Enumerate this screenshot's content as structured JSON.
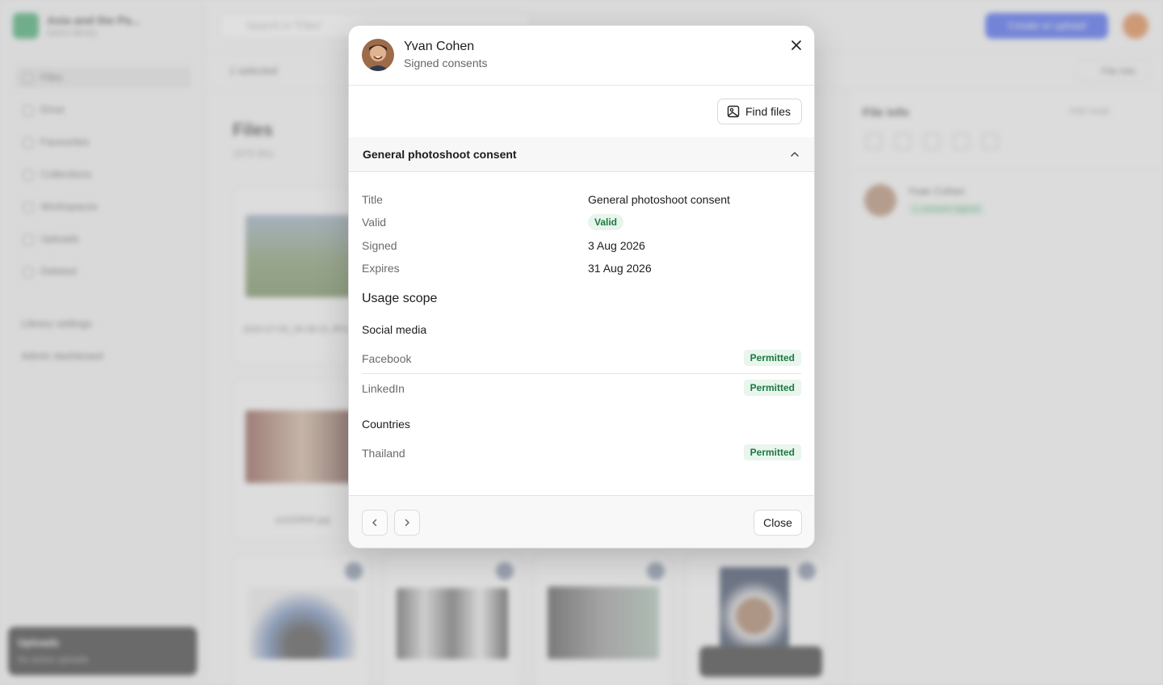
{
  "background": {
    "library": {
      "name": "Asia and the Pa...",
      "subtitle": "Demo library"
    },
    "nav": [
      "Files",
      "Drive",
      "Favourites",
      "Collections",
      "Workspaces",
      "Uploads",
      "Deleted"
    ],
    "nav_sections": [
      "Library settings",
      "Admin dashboard"
    ],
    "uploads_box": {
      "title": "Uploads",
      "subtitle": "No active uploads"
    },
    "search_placeholder": "Search in \"Files\"",
    "create_label": "Create or upload",
    "selection_label": "1 selected",
    "file_info_label": "File info",
    "page_title": "Files",
    "file_count": "1675 files",
    "captions": [
      "2024-07-05_09-38-31.JPG.jpg",
      "p1020845.jpg"
    ],
    "panel": {
      "title": "File info",
      "edit_label": "Edit mode",
      "person": "Yvan Cohen",
      "consent_tag": "1 consent signed"
    }
  },
  "modal": {
    "person_name": "Yvan Cohen",
    "subtitle": "Signed consents",
    "find_files_label": "Find files",
    "consent_title": "General photoshoot consent",
    "details": [
      {
        "label": "Title",
        "value": "General photoshoot consent"
      },
      {
        "label": "Valid",
        "value": "Valid"
      },
      {
        "label": "Signed",
        "value": "3 Aug 2026"
      },
      {
        "label": "Expires",
        "value": "31 Aug 2026"
      }
    ],
    "usage_scope_title": "Usage scope",
    "groups": [
      {
        "title": "Social media",
        "items": [
          {
            "name": "Facebook",
            "status": "Permitted"
          },
          {
            "name": "LinkedIn",
            "status": "Permitted"
          }
        ]
      },
      {
        "title": "Countries",
        "items": [
          {
            "name": "Thailand",
            "status": "Permitted"
          }
        ]
      }
    ],
    "close_label": "Close",
    "icons": {
      "close": "close-icon",
      "find": "image-search-icon",
      "collapse": "chevron-up-icon",
      "prev": "chevron-left-icon",
      "next": "chevron-right-icon"
    },
    "colors": {
      "accent_green": "#1a7a40",
      "badge_bg": "#e7f5ec"
    }
  }
}
